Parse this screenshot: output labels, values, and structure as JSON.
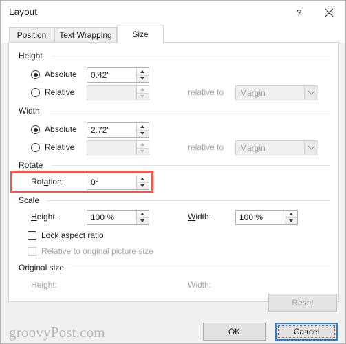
{
  "window": {
    "title": "Layout",
    "help_icon": "question-mark-icon",
    "close_icon": "close-icon"
  },
  "tabs": [
    {
      "label": "Position",
      "active": false
    },
    {
      "label": "Text Wrapping",
      "active": false
    },
    {
      "label": "Size",
      "active": true
    }
  ],
  "groups": {
    "height": {
      "label": "Height",
      "absolute": {
        "label_pre": "Absolut",
        "label_accel": "e",
        "label_post": "",
        "selected": true,
        "value": "0.42\""
      },
      "relative": {
        "label_pre": "Rel",
        "label_accel": "a",
        "label_post": "tive",
        "selected": false,
        "value": ""
      },
      "relative_to_label": "relative to",
      "relative_to_value": "Margin",
      "relative_to_enabled": false
    },
    "width": {
      "label": "Width",
      "absolute": {
        "label_pre": "A",
        "label_accel": "b",
        "label_post": "solute",
        "selected": true,
        "value": "2.72\""
      },
      "relative": {
        "label_pre": "Relat",
        "label_accel": "i",
        "label_post": "ve",
        "selected": false,
        "value": ""
      },
      "relative_to_label": "relative to",
      "relative_to_value": "Margin",
      "relative_to_enabled": false
    },
    "rotate": {
      "label": "Rotate",
      "rotation_label_pre": "Rot",
      "rotation_label_accel": "a",
      "rotation_label_post": "tion:",
      "rotation_value": "0°",
      "highlighted": true,
      "highlight_color": "#ef5a49"
    },
    "scale": {
      "label": "Scale",
      "height_label_accel": "H",
      "height_label_post": "eight:",
      "height_value": "100 %",
      "width_label_accel": "W",
      "width_label_post": "idth:",
      "width_value": "100 %",
      "lock_aspect": {
        "label_pre": "Lock ",
        "label_accel": "a",
        "label_post": "spect ratio",
        "checked": false,
        "enabled": true
      },
      "relative_original": {
        "label": "Relative to original picture size",
        "checked": false,
        "enabled": false
      }
    },
    "original_size": {
      "label": "Original size",
      "height_label": "Height:",
      "height_value": "",
      "width_label": "Width:",
      "width_value": "",
      "reset_label": "Reset",
      "reset_enabled": false
    }
  },
  "footer": {
    "ok_label": "OK",
    "cancel_label": "Cancel",
    "cancel_focused": true
  },
  "watermark": "groovyPost.com"
}
